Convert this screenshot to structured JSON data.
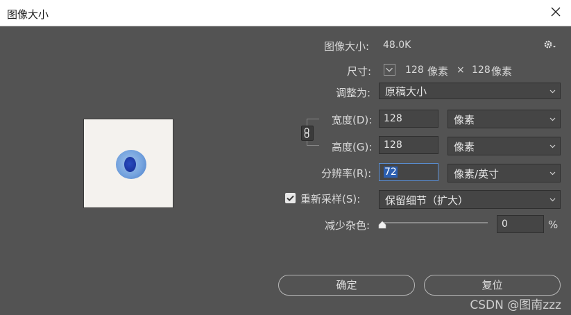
{
  "window": {
    "title": "图像大小"
  },
  "image_size": {
    "label": "图像大小:",
    "value": "48.0K"
  },
  "dimensions": {
    "label": "尺寸:",
    "width_value": "128",
    "unit_1": "像素",
    "times": "×",
    "height_value": "128",
    "unit_2": "像素"
  },
  "fit_to": {
    "label": "调整为:",
    "value": "原稿大小"
  },
  "width": {
    "label": "宽度(D):",
    "value": "128",
    "unit": "像素"
  },
  "height": {
    "label": "高度(G):",
    "value": "128",
    "unit": "像素"
  },
  "resolution": {
    "label": "分辨率(R):",
    "value": "72",
    "unit": "像素/英寸"
  },
  "resample": {
    "label": "重新采样(S):",
    "checked": true,
    "value": "保留细节（扩大）"
  },
  "noise": {
    "label": "减少杂色:",
    "value": "0",
    "unit": "%",
    "level": 0
  },
  "buttons": {
    "ok": "确定",
    "reset": "复位"
  },
  "watermark": "CSDN @图南zzz",
  "colors": {
    "background": "#535353",
    "field": "#454545",
    "accent": "#2c5fb0"
  }
}
